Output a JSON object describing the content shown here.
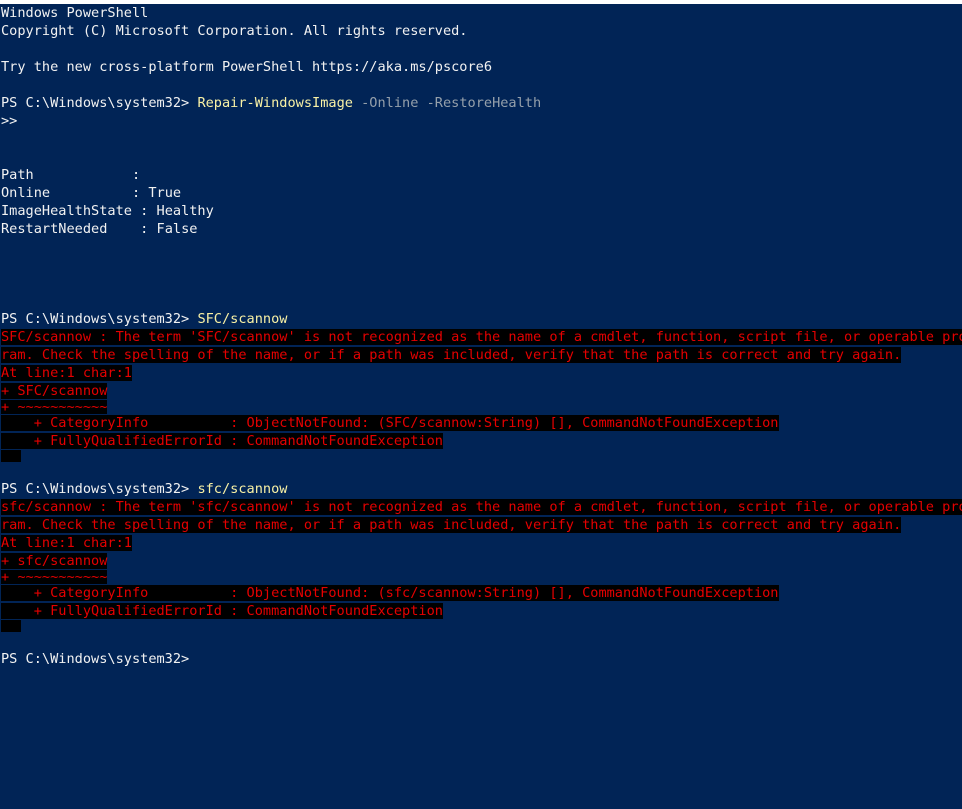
{
  "window": {
    "title": "Windows PowerShell",
    "background_color": "#012456",
    "foreground_color": "#f2f2f2",
    "error_color": "#e50000",
    "error_background_color": "#000000",
    "command_color": "#f9f1a5",
    "parameter_color": "#95a0ab"
  },
  "banner": {
    "line1": "Windows PowerShell",
    "line2": "Copyright (C) Microsoft Corporation. All rights reserved.",
    "line3": "Try the new cross-platform PowerShell https://aka.ms/pscore6"
  },
  "prompt": "PS C:\\Windows\\system32>",
  "continuation_prompt": ">>",
  "session": {
    "command1": {
      "prompt": "PS C:\\Windows\\system32>",
      "cmdlet": "Repair-WindowsImage",
      "params": " -Online -RestoreHealth"
    },
    "result_table": [
      {
        "key": "Path",
        "pad": "            ",
        "sep": ": ",
        "value": ""
      },
      {
        "key": "Online",
        "pad": "          ",
        "sep": ": ",
        "value": "True"
      },
      {
        "key": "ImageHealthState",
        "pad": " ",
        "sep": ": ",
        "value": "Healthy"
      },
      {
        "key": "RestartNeeded",
        "pad": "    ",
        "sep": ": ",
        "value": "False"
      }
    ],
    "command2": {
      "prompt": "PS C:\\Windows\\system32>",
      "cmdlet": "SFC/scannow"
    },
    "error1": {
      "msg_line1": "SFC/scannow : The term 'SFC/scannow' is not recognized as the name of a cmdlet, function, script file, or operable prog",
      "msg_line2": "ram. Check the spelling of the name, or if a path was included, verify that the path is correct and try again.",
      "at_line": "At line:1 char:1",
      "source_line": "+ SFC/scannow",
      "caret_line": "+ ~~~~~~~~~~~",
      "category_info": "    + CategoryInfo          : ObjectNotFound: (SFC/scannow:String) [], CommandNotFoundException",
      "fq_error_id": "    + FullyQualifiedErrorId : CommandNotFoundException"
    },
    "command3": {
      "prompt": "PS C:\\Windows\\system32>",
      "cmdlet": "sfc/scannow"
    },
    "error2": {
      "msg_line1": "sfc/scannow : The term 'sfc/scannow' is not recognized as the name of a cmdlet, function, script file, or operable prog",
      "msg_line2": "ram. Check the spelling of the name, or if a path was included, verify that the path is correct and try again.",
      "at_line": "At line:1 char:1",
      "source_line": "+ sfc/scannow",
      "caret_line": "+ ~~~~~~~~~~~",
      "category_info": "    + CategoryInfo          : ObjectNotFound: (sfc/scannow:String) [], CommandNotFoundException",
      "fq_error_id": "    + FullyQualifiedErrorId : CommandNotFoundException"
    },
    "final_prompt": "PS C:\\Windows\\system32>"
  }
}
